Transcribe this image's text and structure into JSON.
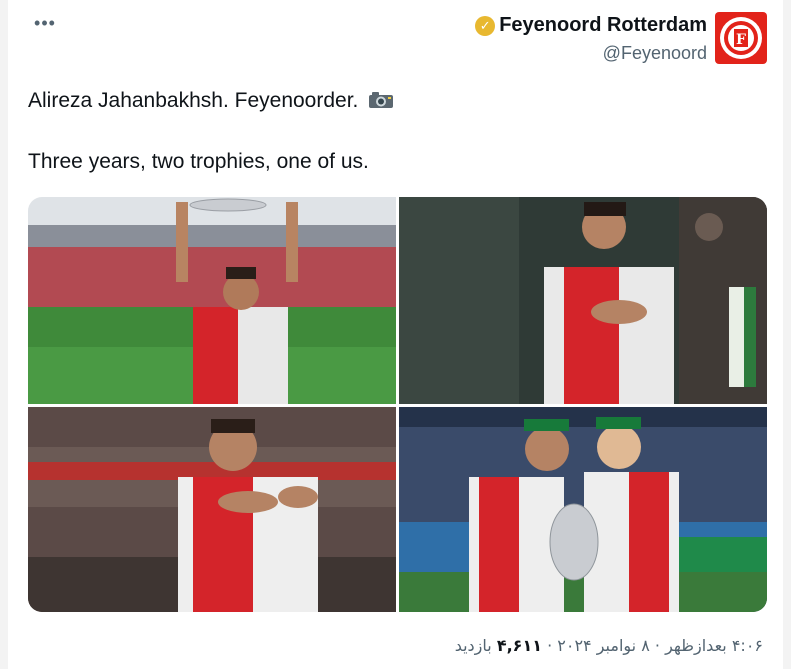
{
  "author": {
    "name": "Feyenoord Rotterdam",
    "handle": "@Feyenoord",
    "avatar_text": "FEYENOORD ROTTERDAM",
    "verified_icon": "gold-check-badge"
  },
  "tweet": {
    "line1": "Alireza Jahanbakhsh. Feyenoorder.",
    "line2": "Three years, two trophies, one of us."
  },
  "media": [
    {
      "alt": "Player lifting trophy above head in stadium"
    },
    {
      "alt": "Player with hand on crest"
    },
    {
      "alt": "Player pointing at shirt crest"
    },
    {
      "alt": "Two players holding a cup"
    }
  ],
  "footer": {
    "time": "۴:۰۶ بعدازظهر",
    "date": "۸ نوامبر ۲۰۲۴",
    "views_count": "۴,۶۱۱",
    "views_label": "بازدید",
    "separator": "·"
  },
  "colors": {
    "brand": "#e2231a",
    "muted": "#536471",
    "text": "#0f1419"
  }
}
